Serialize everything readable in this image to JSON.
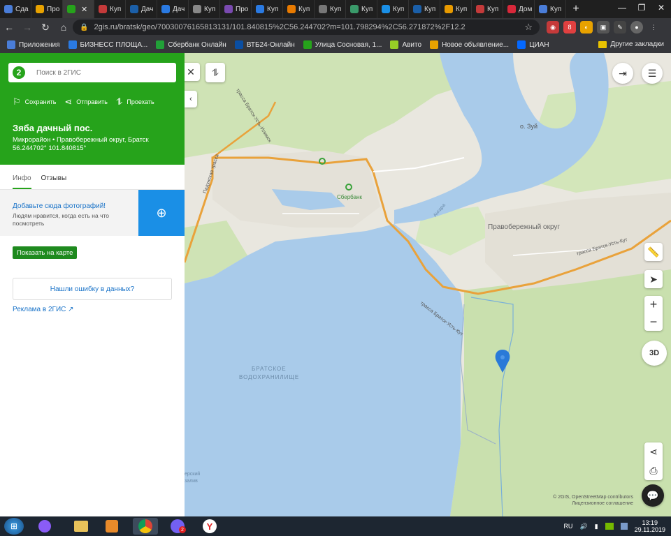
{
  "browser": {
    "tabs": [
      {
        "label": "Сда",
        "color": "#4a7dd8"
      },
      {
        "label": "Про",
        "color": "#e8a200"
      },
      {
        "label": "",
        "color": "#26a31b",
        "active": true
      },
      {
        "label": "Куп",
        "color": "#c43a3a"
      },
      {
        "label": "Дач",
        "color": "#1b5fa8"
      },
      {
        "label": "Дач",
        "color": "#2a7ae2"
      },
      {
        "label": "Куп",
        "color": "#888888"
      },
      {
        "label": "Про",
        "color": "#7a4ab0"
      },
      {
        "label": "Куп",
        "color": "#2a7ae2"
      },
      {
        "label": "Куп",
        "color": "#e87a00"
      },
      {
        "label": "Куп",
        "color": "#777777"
      },
      {
        "label": "Куп",
        "color": "#3a9a6a"
      },
      {
        "label": "Куп",
        "color": "#1a8fe6"
      },
      {
        "label": "Куп",
        "color": "#1b5fa8"
      },
      {
        "label": "Куп",
        "color": "#e89a00"
      },
      {
        "label": "Куп",
        "color": "#c43a3a"
      },
      {
        "label": "Дом",
        "color": "#d8283a"
      },
      {
        "label": "Куп",
        "color": "#4a7dd8"
      }
    ],
    "new_tab": "+",
    "window_controls": [
      "—",
      "❐",
      "✕"
    ],
    "url": "2gis.ru/bratsk/geo/70030076165813131/101.840815%2C56.244702?m=101.798294%2C56.271872%2F12.2",
    "bookmarks": [
      {
        "label": "Приложения",
        "color": "#4a7dd8"
      },
      {
        "label": "БИЗНЕСС ПЛОЩА...",
        "color": "#2a7ae2"
      },
      {
        "label": "Сбербанк Онлайн",
        "color": "#21a038"
      },
      {
        "label": "ВТБ24-Онлайн",
        "color": "#0a4ea2"
      },
      {
        "label": "Улица Сосновая, 1...",
        "color": "#26a31b"
      },
      {
        "label": "Авито",
        "color": "#97cf26"
      },
      {
        "label": "Новое объявление...",
        "color": "#e8a200"
      },
      {
        "label": "ЦИАН",
        "color": "#0468ff"
      }
    ],
    "other_bookmarks": "Другие закладки"
  },
  "sidebar": {
    "search_placeholder": "Поиск в 2ГИС",
    "logo_text": "2",
    "actions": {
      "save": "Сохранить",
      "send": "Отправить",
      "route": "Проехать"
    },
    "title": "Зяба дачный пос.",
    "subtitle_line1": "Микрорайон • Правобережный округ, Братск",
    "coords": "56.244702° 101.840815°",
    "tabs": [
      "Инфо",
      "Отзывы"
    ],
    "photo_link": "Добавьте сюда фотографий!",
    "photo_text": "Людям нравится, когда есть на что посмотреть",
    "show_on_map": "Показать на карте",
    "report_error": "Нашли ошибку в данных?",
    "ads": "Реклама в 2ГИС ↗"
  },
  "map": {
    "labels": {
      "island": "о. Зуй",
      "district": "Правобережный округ",
      "bank": "Сбербанк",
      "reservoir_1": "БРАТСКОЕ",
      "reservoir_2": "ВОДОХРАНИЛИЩЕ",
      "road_1": "трасса Братск-Усть-Илимск",
      "road_2": "трасса Братск-Усть-Кут",
      "road_3": "Падунская трасса",
      "river": "Ангара",
      "edge_label_1": "ерский",
      "edge_label_2": "залив"
    },
    "attribution_line1": "© 2GIS, OpenStreetMap contributors",
    "attribution_line2": "Лицензионное соглашение",
    "btn_3d": "3D"
  },
  "taskbar": {
    "lang": "RU",
    "time": "13:19",
    "date": "29.11.2019",
    "viber_badge": "2"
  }
}
